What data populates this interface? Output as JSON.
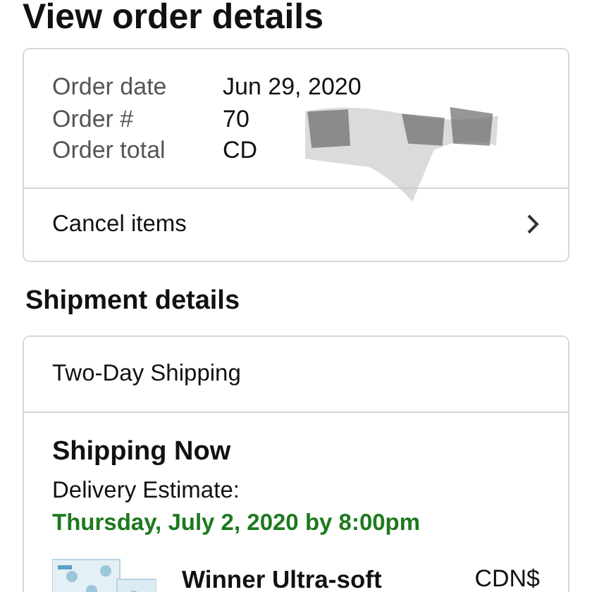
{
  "title": "View order details",
  "order_summary": {
    "rows": [
      {
        "label": "Order date",
        "value": "Jun 29, 2020"
      },
      {
        "label": "Order #",
        "value": "70"
      },
      {
        "label": "Order total",
        "value": "CD"
      }
    ],
    "action": "Cancel items"
  },
  "shipment": {
    "heading": "Shipment details",
    "speed": "Two-Day Shipping",
    "status": "Shipping Now",
    "estimate_label": "Delivery Estimate:",
    "estimate_date": "Thursday, July 2, 2020 by 8:00pm",
    "items": [
      {
        "name": "Winner Ultra-soft",
        "price": "CDN$"
      }
    ]
  }
}
